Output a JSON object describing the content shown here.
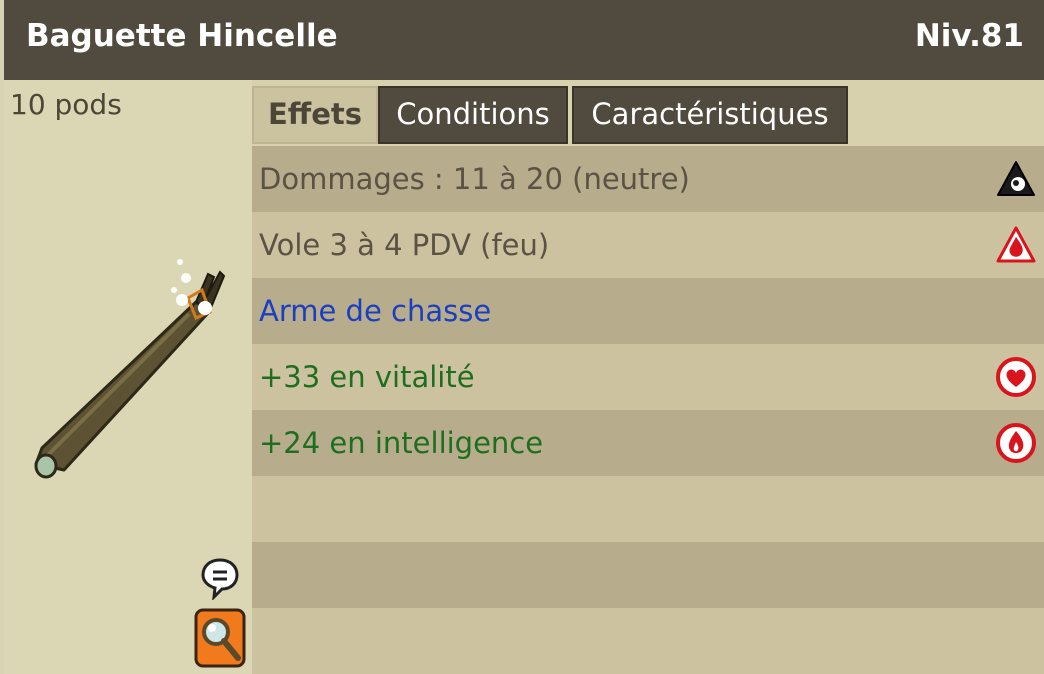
{
  "item": {
    "name": "Baguette Hincelle",
    "level": "Niv.81",
    "weight": "10 pods"
  },
  "tabs": [
    {
      "label": "Effets",
      "active": true
    },
    {
      "label": "Conditions",
      "active": false
    },
    {
      "label": "Caractéristiques",
      "active": false
    }
  ],
  "effects": [
    {
      "text": "Dommages : 11 à 20 (neutre)",
      "color": "#5a5244",
      "icon": "neutral-element-icon"
    },
    {
      "text": "Vole 3 à 4 PDV (feu)",
      "color": "#5a5244",
      "icon": "fire-element-icon"
    },
    {
      "text": "Arme de chasse",
      "color": "#1b3fc0",
      "icon": ""
    },
    {
      "text": "+33 en vitalité",
      "color": "#1f6e1f",
      "icon": "vitality-heart-icon"
    },
    {
      "text": "+24 en intelligence",
      "color": "#1f6e1f",
      "icon": "intelligence-flame-icon"
    }
  ],
  "colors": {
    "header_bg": "#514a3e",
    "accent_red": "#d9141c",
    "search_orange": "#f07a1c"
  }
}
